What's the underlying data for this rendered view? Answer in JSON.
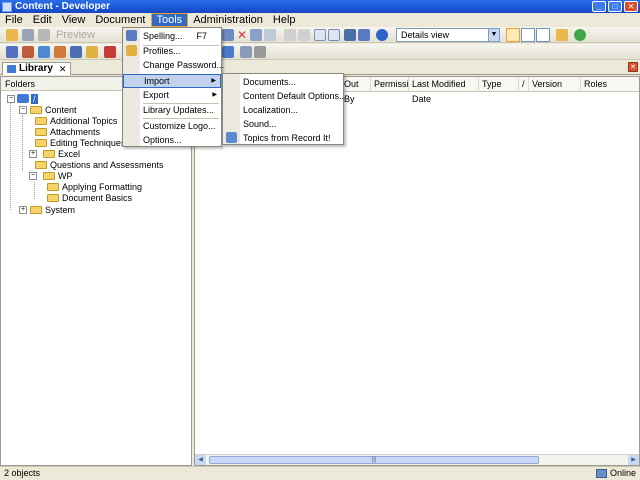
{
  "window": {
    "title": "Content - Developer",
    "minimize": "_",
    "maximize": "□",
    "close": "✕"
  },
  "menubar": [
    "File",
    "Edit",
    "View",
    "Document",
    "Tools",
    "Administration",
    "Help"
  ],
  "toolbar": {
    "preview_label": "Preview",
    "view_select": "Details view",
    "view_select_arrow": "▼"
  },
  "tab": {
    "label": "Library",
    "close": "✕",
    "pane_close": "✕"
  },
  "folders": {
    "header": "Folders",
    "root": "/",
    "items": [
      {
        "label": "Content",
        "expander": "−"
      },
      {
        "label": "Additional Topics"
      },
      {
        "label": "Attachments"
      },
      {
        "label": "Editing Techniques"
      },
      {
        "label": "Excel",
        "expander": "+"
      },
      {
        "label": "Questions and Assessments"
      },
      {
        "label": "WP",
        "expander": "−"
      },
      {
        "label": "Applying Formatting"
      },
      {
        "label": "Document Basics"
      },
      {
        "label": "System",
        "expander": "+"
      }
    ]
  },
  "columns": [
    "Out By",
    "Permission",
    "Last Modified Date",
    "Type",
    "/",
    "Version",
    "Roles"
  ],
  "tools_menu": {
    "items": [
      {
        "label": "Spelling...",
        "shortcut": "F7"
      },
      {
        "label": "Profiles..."
      },
      {
        "label": "Change Password..."
      },
      {
        "label": "Import",
        "arrow": "▶"
      },
      {
        "label": "Export",
        "arrow": "▶"
      },
      {
        "label": "Library Updates..."
      },
      {
        "label": "Customize Logo..."
      },
      {
        "label": "Options..."
      }
    ]
  },
  "import_menu": {
    "items": [
      {
        "label": "Documents..."
      },
      {
        "label": "Content Default Options..."
      },
      {
        "label": "Localization..."
      },
      {
        "label": "Sound..."
      },
      {
        "label": "Topics from Record It!"
      }
    ]
  },
  "scrollbar": {
    "left": "◀",
    "right": "▶",
    "grip": "|||"
  },
  "status": {
    "count": "2 objects",
    "mode": "Online"
  }
}
